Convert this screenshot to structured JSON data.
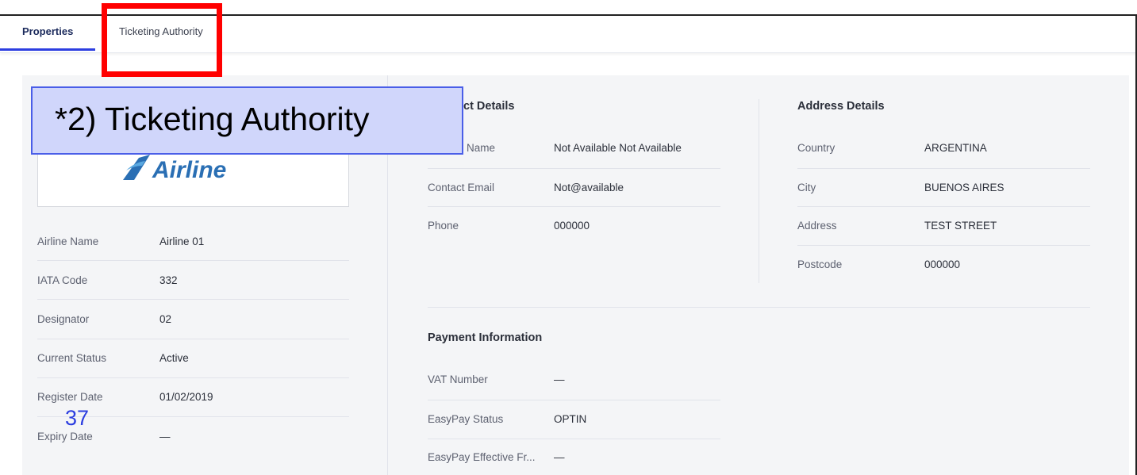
{
  "tabs": [
    {
      "label": "Properties",
      "active": true
    },
    {
      "label": "Ticketing Authority",
      "active": false
    }
  ],
  "logo": {
    "text": "Airline",
    "icon": "airline-swoosh-icon"
  },
  "airline_fields": [
    {
      "label": "Airline Name",
      "value": "Airline 01"
    },
    {
      "label": "IATA Code",
      "value": "332"
    },
    {
      "label": "Designator",
      "value": "02"
    },
    {
      "label": "Current Status",
      "value": "Active"
    },
    {
      "label": "Register Date",
      "value": "01/02/2019"
    },
    {
      "label": "Expiry Date",
      "value": "—"
    }
  ],
  "contact": {
    "header": "ct Details",
    "fields": [
      {
        "label": "Name",
        "value": "Not Available Not Available"
      },
      {
        "label": "Contact Email",
        "value": "Not@available"
      },
      {
        "label": "Phone",
        "value": "000000"
      }
    ]
  },
  "address": {
    "header": "Address Details",
    "fields": [
      {
        "label": "Country",
        "value": "ARGENTINA"
      },
      {
        "label": "City",
        "value": "BUENOS AIRES"
      },
      {
        "label": "Address",
        "value": "TEST STREET"
      },
      {
        "label": "Postcode",
        "value": "000000"
      }
    ]
  },
  "payment": {
    "header": "Payment Information",
    "fields": [
      {
        "label": "VAT Number",
        "value": "—"
      },
      {
        "label": "EasyPay Status",
        "value": "OPTIN"
      },
      {
        "label": "EasyPay Effective Fr...",
        "value": "—"
      }
    ]
  },
  "annotation": {
    "callout": "*2) Ticketing Authority",
    "step": "37"
  },
  "colors": {
    "accent": "#2c3ee0",
    "highlight": "#ff0000",
    "callout_bg": "#d0d6fb"
  }
}
